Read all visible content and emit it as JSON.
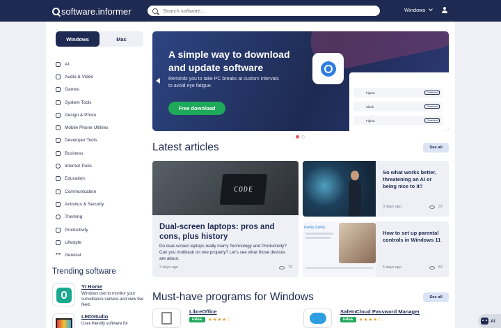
{
  "header": {
    "logo": "software.informer",
    "search_placeholder": "Search software...",
    "os_label": "Windows"
  },
  "sidebar": {
    "tabs": [
      {
        "label": "Windows",
        "active": true
      },
      {
        "label": "Mac",
        "active": false
      }
    ],
    "categories": [
      "AI",
      "Audio & Video",
      "Games",
      "System Tools",
      "Design & Photo",
      "Mobile Phone Utilities",
      "Developer Tools",
      "Business",
      "Internet Tools",
      "Education",
      "Communication",
      "Antivirus & Security",
      "Theming",
      "Productivity",
      "Lifestyle",
      "General"
    ],
    "trending_title": "Trending software",
    "trending": [
      {
        "name": "YI Home",
        "desc": "Windows tool to monitor your surveillance camera and view live feed."
      },
      {
        "name": "LEDStudio",
        "desc": "User-friendly software for"
      }
    ]
  },
  "hero": {
    "title": "A simple way to download and update software",
    "subtitle": "Reminds you to take PC breaks at custom intervals to avoid eye fatigue.",
    "cta": "Free download",
    "shot_rows": [
      "Figma",
      "Slack",
      "Figma"
    ],
    "shot_button": "Download"
  },
  "articles": {
    "title": "Latest articles",
    "see_all": "See all",
    "main": {
      "image_text": "CODE",
      "title": "Dual-screen laptops: pros and cons, plus history",
      "excerpt": "Do dual-screen laptops really marry Technology and Productivity? Can you multitask on one properly? Let's see what those devices are about.",
      "date": "3 days ago",
      "views": "72"
    },
    "side": [
      {
        "title": "So what works better, threatening an AI or being nice to it?",
        "date": "3 days ago",
        "views": "37"
      },
      {
        "title": "How to set up parental controls in Windows 11",
        "date": "5 days ago",
        "views": "52",
        "image_caption": "Family Safety"
      }
    ]
  },
  "musthave": {
    "title": "Must-have programs for Windows",
    "see_all": "See all",
    "programs": [
      {
        "name": "LibreOffice",
        "badge": "FREE",
        "stars": "★★★★☆"
      },
      {
        "name": "SafeInCloud Password Manager",
        "badge": "FREE",
        "stars": "★★★★☆"
      }
    ]
  },
  "chat": {
    "label": "AI"
  },
  "colors": {
    "navy": "#1e2a52",
    "accent_green": "#1fa95a",
    "dot_active": "#e85b5b"
  }
}
